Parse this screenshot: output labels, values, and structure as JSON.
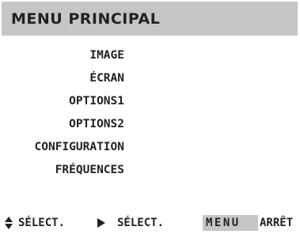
{
  "header": {
    "title": "MENU PRINCIPAL"
  },
  "menu": {
    "items": [
      {
        "label": "IMAGE"
      },
      {
        "label": "ÉCRAN"
      },
      {
        "label": "OPTIONS1"
      },
      {
        "label": "OPTIONS2"
      },
      {
        "label": "CONFIGURATION"
      },
      {
        "label": "FRÉQUENCES"
      }
    ]
  },
  "footer": {
    "updown_icon": "up-down-triangle-icon",
    "updown_label": "SÉLECT.",
    "right_icon": "right-triangle-icon",
    "right_label": "SÉLECT.",
    "menu_key": "MENU",
    "menu_label": "ARRÊT"
  },
  "colors": {
    "background": "#ffffff",
    "header_bar": "#c6c6c6",
    "menu_key_bg": "#c6c6c6",
    "text": "#222222"
  }
}
